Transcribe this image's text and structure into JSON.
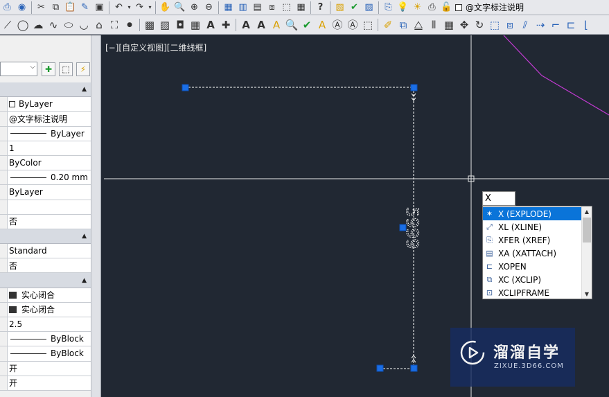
{
  "toolbar_top": {
    "layer_name": "@文字标注说明"
  },
  "palette": {
    "rows": [
      {
        "type": "cat"
      },
      {
        "value": "ByLayer",
        "swatch": "box"
      },
      {
        "value": "@文字标注说明"
      },
      {
        "value": "ByLayer",
        "line": true
      },
      {
        "value": "1"
      },
      {
        "value": "ByColor"
      },
      {
        "value": "0.20 mm",
        "line": true
      },
      {
        "value": "ByLayer"
      },
      {
        "value": ""
      },
      {
        "value": "否"
      },
      {
        "type": "cat"
      },
      {
        "value": "Standard"
      },
      {
        "value": "否"
      },
      {
        "type": "cat"
      },
      {
        "value": "实心闭合",
        "swatch": "fill"
      },
      {
        "value": "实心闭合",
        "swatch": "fill"
      },
      {
        "value": "2.5"
      },
      {
        "value": "ByBlock",
        "line": true
      },
      {
        "value": "ByBlock",
        "line": true
      },
      {
        "value": "开"
      },
      {
        "value": "开"
      }
    ]
  },
  "canvas": {
    "viewport_label": "[−][自定义视图][二维线框]",
    "dimension_text": "5999"
  },
  "command": {
    "input_value": "X",
    "suggestions": [
      {
        "label": "X (EXPLODE)",
        "icon": "explode-icon",
        "glyph": "✶",
        "selected": true
      },
      {
        "label": "XL (XLINE)",
        "icon": "xline-icon",
        "glyph": "⤢",
        "selected": false
      },
      {
        "label": "XFER (XREF)",
        "icon": "xref-icon",
        "glyph": "⎘",
        "selected": false
      },
      {
        "label": "XA (XATTACH)",
        "icon": "xattach-icon",
        "glyph": "▤",
        "selected": false
      },
      {
        "label": "XOPEN",
        "icon": "xopen-icon",
        "glyph": "⊏",
        "selected": false
      },
      {
        "label": "XC (XCLIP)",
        "icon": "xclip-icon",
        "glyph": "⧉",
        "selected": false
      },
      {
        "label": "XCLIPFRAME",
        "icon": "xclipframe-icon",
        "glyph": "⊡",
        "selected": false
      }
    ]
  },
  "watermark": {
    "title": "溜溜自学",
    "subtitle": "ZIXUE.3D66.COM"
  },
  "colors": {
    "canvas_bg": "#212833",
    "selection_blue": "#0a74d9",
    "grip_blue": "#1a6ee6",
    "polyline_magenta": "#c03ad0"
  }
}
